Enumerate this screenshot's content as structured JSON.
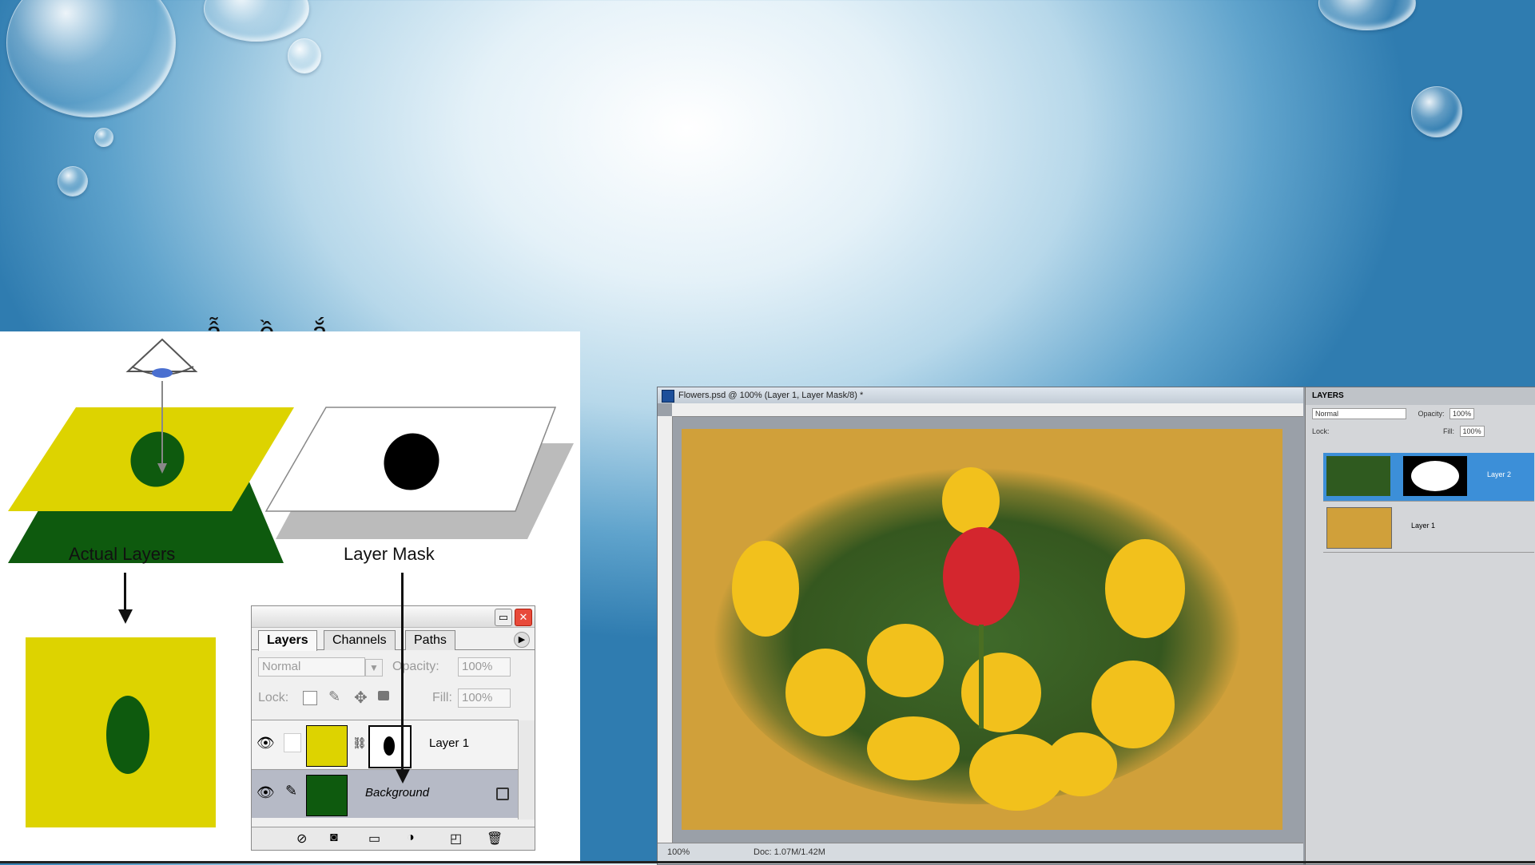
{
  "slide": {
    "partial_title": "...ẫ ... ề ... ắ ..."
  },
  "diagram": {
    "caption_actual_layers": "Actual Layers",
    "caption_layer_mask": "Layer Mask",
    "colors": {
      "yellow": "#ddd300",
      "dark_green": "#0e5a0e",
      "mask_black": "#000000"
    }
  },
  "layers_palette": {
    "tabs": [
      "Layers",
      "Channels",
      "Paths"
    ],
    "blend_mode": "Normal",
    "opacity_label": "Opacity:",
    "opacity_value": "100%",
    "lock_label": "Lock:",
    "fill_label": "Fill:",
    "fill_value": "100%",
    "layers": [
      {
        "name": "Layer 1",
        "thumb_color": "#ddd300",
        "has_mask": true
      },
      {
        "name": "Background",
        "thumb_color": "#0e5a0e",
        "locked": true
      }
    ]
  },
  "photoshop": {
    "doc_title": "Flowers.psd @ 100% (Layer 1, Layer Mask/8) *",
    "status_zoom": "100%",
    "status_doc": "Doc: 1.07M/1.42M",
    "panel_title": "LAYERS",
    "panel_blend": "Normal",
    "panel_opacity_label": "Opacity:",
    "panel_opacity": "100%",
    "panel_lock_label": "Lock:",
    "panel_fill_label": "Fill:",
    "panel_fill": "100%",
    "panel_layers": [
      "Layer 2",
      "Layer 1"
    ],
    "canvas_color": "#d0a03a"
  }
}
